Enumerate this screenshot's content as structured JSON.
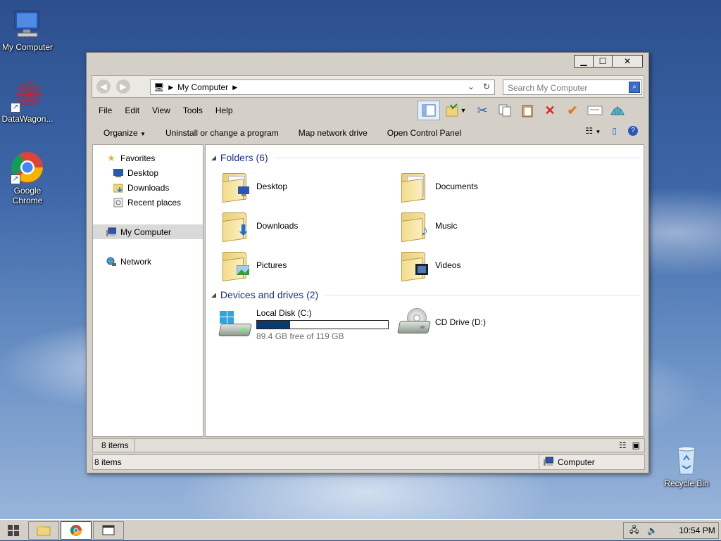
{
  "desktop": {
    "icons": [
      {
        "label": "My Computer"
      },
      {
        "label": "DataWagon..."
      },
      {
        "label": "Google Chrome"
      },
      {
        "label": "Recycle Bin"
      }
    ]
  },
  "window": {
    "address": {
      "location": "My Computer"
    },
    "search": {
      "placeholder": "Search My Computer"
    },
    "menu": [
      "File",
      "Edit",
      "View",
      "Tools",
      "Help"
    ],
    "commands": [
      "Organize",
      "Uninstall or change a program",
      "Map network drive",
      "Open Control Panel"
    ],
    "nav": {
      "favorites": "Favorites",
      "desktop": "Desktop",
      "downloads": "Downloads",
      "recent": "Recent places",
      "computer": "My Computer",
      "network": "Network"
    },
    "groups": {
      "folders": "Folders (6)",
      "devices": "Devices and drives (2)"
    },
    "folders": [
      "Desktop",
      "Documents",
      "Downloads",
      "Music",
      "Pictures",
      "Videos"
    ],
    "drives": {
      "c": {
        "name": "Local Disk (C:)",
        "free_text": "89.4 GB free of 119 GB",
        "used_fraction": 0.25
      },
      "d": {
        "name": "CD Drive (D:)"
      }
    },
    "details": {
      "count": "8 items"
    },
    "status": {
      "count": "8 items",
      "location": "Computer"
    }
  },
  "taskbar": {
    "clock": "10:54 PM"
  },
  "colors": {
    "accent": "#1e3287",
    "drive_fill": "#0c3a6e"
  }
}
